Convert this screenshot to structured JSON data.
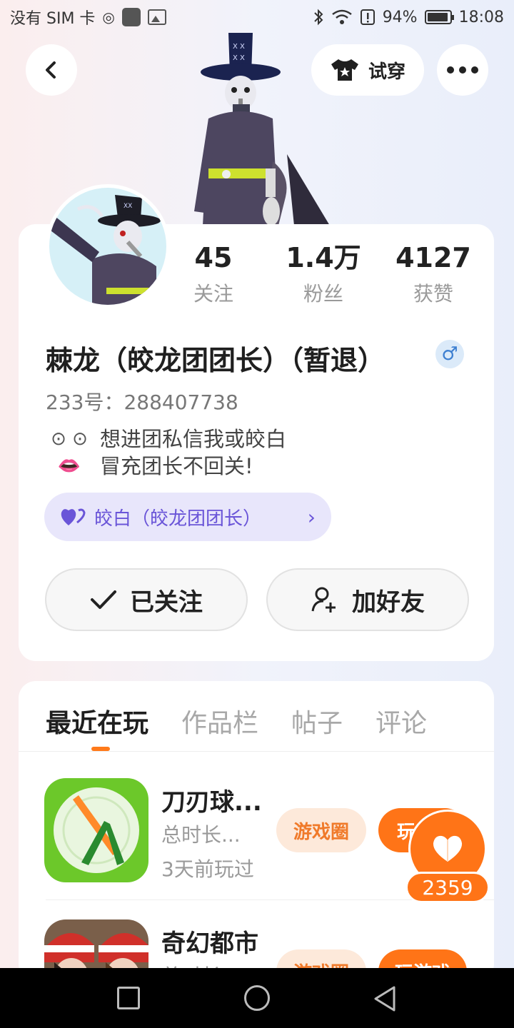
{
  "status_bar": {
    "carrier": "没有 SIM 卡",
    "battery": "94%",
    "battery_level": 0.94,
    "time": "18:08"
  },
  "header": {
    "back_icon": "chevron-left-icon",
    "try_on_label": "试穿",
    "try_on_icon": "tshirt-icon",
    "more_icon": "more-horizontal-icon"
  },
  "profile": {
    "stats": [
      {
        "value": "45",
        "label": "关注"
      },
      {
        "value": "1.4万",
        "label": "粉丝"
      },
      {
        "value": "4127",
        "label": "获赞"
      }
    ],
    "name": "棘龙（皎龙团团长）（暂退）",
    "gender_symbol": "♂",
    "uid": "233号：288407738",
    "bio_lines": [
      {
        "icon": "⊙ ⊙",
        "text": "想进团私信我或皎白"
      },
      {
        "icon": "👄",
        "text": "冒充团长不回关!"
      }
    ],
    "partner": {
      "label": "皎白（皎龙团团长）",
      "icon": "heart-icon"
    },
    "follow_label": "已关注",
    "add_friend_label": "加好友"
  },
  "tabs": [
    "最近在玩",
    "作品栏",
    "帖子",
    "评论"
  ],
  "games": [
    {
      "title": "刀刃球...",
      "duration": "总时长...",
      "last_played": "3天前玩过",
      "circle_label": "游戏圈",
      "play_label": "玩"
    },
    {
      "title": "奇幻都市",
      "duration": "总时长",
      "circle_label": "游戏圈",
      "play_label": "玩游戏"
    }
  ],
  "like": {
    "count": "2359"
  },
  "colors": {
    "accent": "#ff7417",
    "partner_bg": "#e8e6fb",
    "partner_text": "#6a55d8"
  }
}
